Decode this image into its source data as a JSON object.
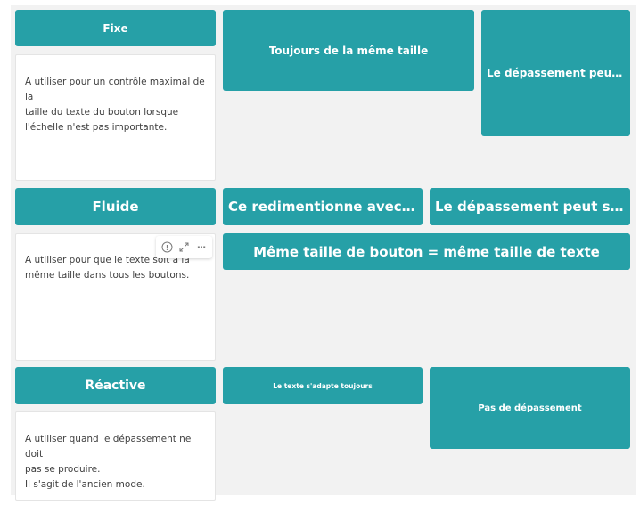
{
  "colors": {
    "accent": "#26a0a7",
    "canvas": "#f2f2f2",
    "text": "#404040"
  },
  "rows": [
    {
      "header": "Fixe",
      "description": [
        "A utiliser pour un contrôle maximal de la",
        "taille du texte du bouton lorsque",
        "l'échelle n'est pas importante."
      ],
      "buttons": [
        "Toujours de la même taille",
        "Le dépassement peut se produire"
      ]
    },
    {
      "header": "Fluide",
      "description": [
        "A utiliser pour que le texte soit à la",
        "même taille dans tous les boutons."
      ],
      "buttons": [
        "Ce redimentionne avec la taille du bouton",
        "Le dépassement peut se produire",
        "Même taille de bouton = même taille de texte"
      ]
    },
    {
      "header": "Réactive",
      "description": [
        "A utiliser quand le dépassement ne doit",
        "pas se produire.",
        "Il s'agit de l'ancien mode."
      ],
      "buttons": [
        "Le texte s'adapte toujours",
        "Pas de dépassement"
      ]
    }
  ],
  "toolbar": {
    "icons": [
      "info-icon",
      "expand-icon",
      "more-icon"
    ],
    "more_glyph": "···"
  }
}
